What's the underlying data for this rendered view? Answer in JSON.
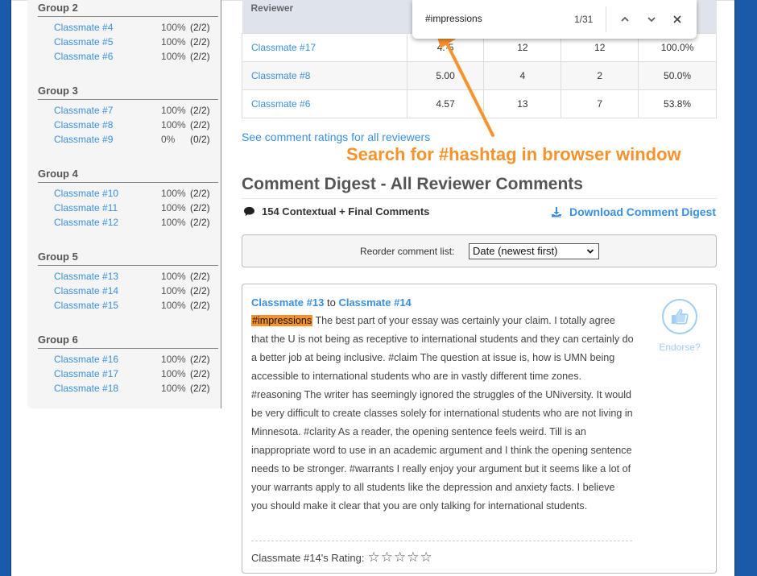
{
  "sidebar": {
    "groups": [
      {
        "title": "Group 2",
        "members": [
          {
            "name": "Classmate #4",
            "pct": "100%",
            "frac": "(2/2)"
          },
          {
            "name": "Classmate #5",
            "pct": "100%",
            "frac": "(2/2)"
          },
          {
            "name": "Classmate #6",
            "pct": "100%",
            "frac": "(2/2)"
          }
        ]
      },
      {
        "title": "Group 3",
        "members": [
          {
            "name": "Classmate #7",
            "pct": "100%",
            "frac": "(2/2)"
          },
          {
            "name": "Classmate #8",
            "pct": "100%",
            "frac": "(2/2)"
          },
          {
            "name": "Classmate #9",
            "pct": "0%",
            "frac": "(0/2)"
          }
        ]
      },
      {
        "title": "Group 4",
        "members": [
          {
            "name": "Classmate #10",
            "pct": "100%",
            "frac": "(2/2)"
          },
          {
            "name": "Classmate #11",
            "pct": "100%",
            "frac": "(2/2)"
          },
          {
            "name": "Classmate #12",
            "pct": "100%",
            "frac": "(2/2)"
          }
        ]
      },
      {
        "title": "Group 5",
        "members": [
          {
            "name": "Classmate #13",
            "pct": "100%",
            "frac": "(2/2)"
          },
          {
            "name": "Classmate #14",
            "pct": "100%",
            "frac": "(2/2)"
          },
          {
            "name": "Classmate #15",
            "pct": "100%",
            "frac": "(2/2)"
          }
        ]
      },
      {
        "title": "Group 6",
        "members": [
          {
            "name": "Classmate #16",
            "pct": "100%",
            "frac": "(2/2)"
          },
          {
            "name": "Classmate #17",
            "pct": "100%",
            "frac": "(2/2)"
          },
          {
            "name": "Classmate #18",
            "pct": "100%",
            "frac": "(2/2)"
          }
        ]
      }
    ]
  },
  "reviewer_table": {
    "header": "Reviewer",
    "rows": [
      {
        "reviewer": "Classmate #17",
        "score": "4.·5",
        "c2": "12",
        "c3": "12",
        "pct": "100.0%"
      },
      {
        "reviewer": "Classmate #8",
        "score": "5.00",
        "c2": "4",
        "c3": "2",
        "pct": "50.0%"
      },
      {
        "reviewer": "Classmate #6",
        "score": "4.57",
        "c2": "13",
        "c3": "7",
        "pct": "53.8%"
      }
    ]
  },
  "see_all_link": "See comment ratings for all reviewers",
  "annotation": {
    "text": "Search for #hashtag in browser window",
    "color": "#f7922d"
  },
  "digest": {
    "title": "Comment Digest - All Reviewer Comments",
    "count_label": "154 Contextual + Final Comments",
    "download_label": "Download Comment Digest",
    "reorder_label": "Reorder comment list:",
    "reorder_selected": "Date (newest first)"
  },
  "comment": {
    "from": "Classmate #13",
    "connector": "to",
    "to": "Classmate #14",
    "highlight_tag": "#impressions",
    "text": " The best part of your essay was certainly your claim. I totally agree that the U is not being as receptive to international students and they can certainly do a better job at being inclusive. #claim The question at issue is, how is UMN being accessible to international students who are in vastly different time zones. #reasoning The writer has seemingly ignored the struggles of the UNiversity. It would be very difficult to create classes solely for international students who are not living in Minnesota. #clarity As a reader, the opening sentence feels weird. Till is an inappropriate word to use in an academic argument and I think the opening sentence needs to be stronger. #warrants I really enjoy your argument but it seems like a lot of your warrants apply to all students like the depression and anxiety facts. I believe you should make it clear that you are only talking for international students.",
    "endorse_label": "Endorse?",
    "rating_label": "Classmate #14's Rating:",
    "rating_value": 0,
    "rating_max": 5
  },
  "findbar": {
    "query": "#impressions",
    "count": "1/31",
    "icons": [
      "chevron-up-icon",
      "chevron-down-icon",
      "close-icon"
    ]
  },
  "colors": {
    "brand_blue": "#1a5aa6",
    "link_blue": "#3a8fe0",
    "highlight_orange": "#f7922d"
  }
}
